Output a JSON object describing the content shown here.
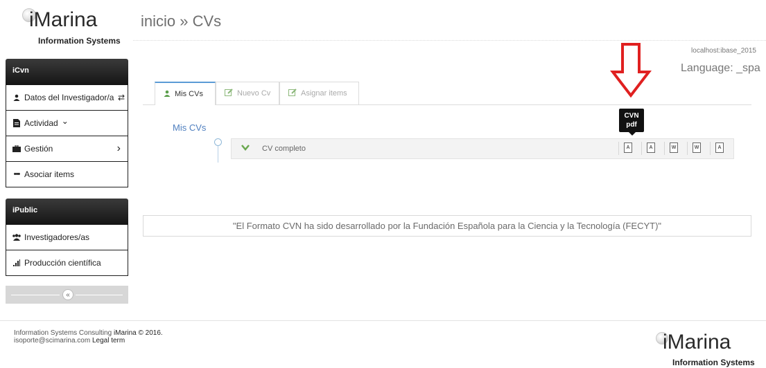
{
  "brand": {
    "name": "iMarina",
    "tagline": "Information Systems"
  },
  "breadcrumb": "inicio » CVs",
  "server": "localhost:ibase_2015",
  "language": "Language: _spa",
  "sidebar": {
    "icvn": {
      "header": "iCvn",
      "items": [
        {
          "label": "Datos del Investigador/a",
          "icon": "user-icon",
          "trail": "⇄"
        },
        {
          "label": "Actividad",
          "icon": "document-icon",
          "trail": "⌄"
        },
        {
          "label": "Gestión",
          "icon": "briefcase-icon",
          "trail": "›"
        },
        {
          "label": "Asociar items",
          "icon": "ellipsis-icon",
          "trail": ""
        }
      ]
    },
    "ipublic": {
      "header": "iPublic",
      "items": [
        {
          "label": "Investigadores/as",
          "icon": "users-icon"
        },
        {
          "label": "Producción científica",
          "icon": "bar-chart-icon"
        }
      ]
    },
    "collapse_glyph": "«"
  },
  "tabs": [
    {
      "label": "Mis CVs",
      "icon": "user-icon",
      "active": true
    },
    {
      "label": "Nuevo Cv",
      "icon": "edit-icon",
      "active": false
    },
    {
      "label": "Asignar items",
      "icon": "edit-icon",
      "active": false
    }
  ],
  "section_title": "Mis CVs",
  "cv_row": {
    "label": "CV completo",
    "chevron": "⌄",
    "actions": [
      {
        "icon": "pdf-icon",
        "glyph": "A"
      },
      {
        "icon": "pdf-icon",
        "glyph": "A"
      },
      {
        "icon": "word-icon",
        "glyph": "W"
      },
      {
        "icon": "word-icon",
        "glyph": "W"
      },
      {
        "icon": "pdf-icon",
        "glyph": "A"
      }
    ],
    "tooltip_line1": "CVN",
    "tooltip_line2": "pdf"
  },
  "notice": "\"El Formato CVN ha sido desarrollado por la Fundación Española para la Ciencia y la Tecnología (FECYT)\"",
  "footer": {
    "line1_prefix": "Information Systems Consulting ",
    "line1_brand": "iMarina © 2016.",
    "line2_prefix": "isoporte@scimarina.com ",
    "line2_link": "Legal term"
  },
  "colors": {
    "accent": "#5b9bd5",
    "annotation_arrow": "#e02020",
    "check": "#6aa84f",
    "sidebar_header": "#1a1a1a"
  }
}
